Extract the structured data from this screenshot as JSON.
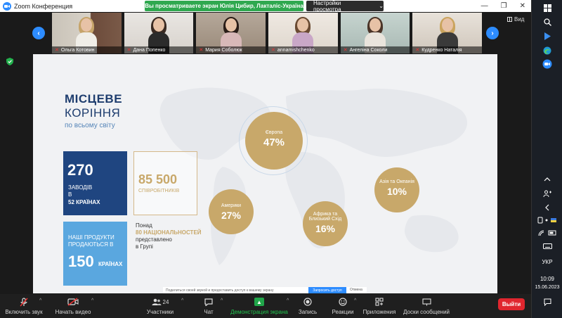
{
  "window": {
    "app_title": "Zoom Конференция",
    "share_banner": "Вы просматриваете экран Юлія Цибир, Лакталіс-Україна",
    "view_options_label": "Настройки просмотра",
    "view_options_caret": "⌄",
    "controls": {
      "minimize": "—",
      "restore": "❐",
      "close": "✕"
    }
  },
  "gallery": {
    "prev_arrow": "‹",
    "next_arrow": "›",
    "view_label": "Вид",
    "participants": [
      {
        "name": "Ольга Котовин",
        "muted": true
      },
      {
        "name": "Дана Попенко",
        "muted": true
      },
      {
        "name": "Мария Соболюк",
        "muted": true
      },
      {
        "name": "annamishchenko",
        "muted": true
      },
      {
        "name": "Ангеліна Соколи",
        "muted": true
      },
      {
        "name": "Кудренко Наталія",
        "muted": true
      }
    ]
  },
  "slide": {
    "title_line1": "МІСЦЕВЕ",
    "title_line2": "КОРІННЯ",
    "subtitle": "по всьому світу",
    "plants": {
      "value": "270",
      "line1": "ЗАВОДІВ",
      "line2": "В",
      "line3": "52 КРАЇНАХ"
    },
    "employees": {
      "value": "85 500",
      "label": "СПІВРОБІТНИКІВ"
    },
    "products": {
      "line1": "НАШІ ПРОДУКТИ",
      "line2": "ПРОДАЮТЬСЯ В",
      "value": "150",
      "unit": "КРАЇНАХ"
    },
    "nationalities": {
      "line1": "Понад",
      "line2": "80 НАЦІОНАЛЬНОСТЕЙ",
      "line3": "представлено",
      "line4": "в Групі"
    },
    "regions": [
      {
        "id": "europe",
        "label": "Європа",
        "share": "47%"
      },
      {
        "id": "americas",
        "label": "Америки",
        "share": "27%"
      },
      {
        "id": "africa",
        "label_line1": "Африка та",
        "label_line2": "Близький Схід",
        "share": "16%"
      },
      {
        "id": "asia",
        "label": "Азія та Океанія",
        "share": "10%"
      }
    ]
  },
  "permission_bar": {
    "text": "Поделиться своей звукой и предоставить доступ к вашему экрану",
    "button": "Запросить доступ",
    "cancel": "Отмена"
  },
  "toolbar": {
    "mute": "Включить звук",
    "video": "Начать видео",
    "participants": "Участники",
    "participants_count": "24",
    "chat": "Чат",
    "share": "Демонстрация экрана",
    "record": "Запись",
    "reactions": "Реакции",
    "apps": "Приложения",
    "whiteboard": "Доски сообщений",
    "leave": "Выйти",
    "caret": "^"
  },
  "taskbar": {
    "language": "УКР",
    "time": "10:09",
    "date": "15.06.2023"
  },
  "colors": {
    "zoom_blue": "#2d8cff",
    "banner_green": "#2fa84f",
    "navy": "#1f4580",
    "gold": "#c8a86a",
    "light_blue": "#5aa7df",
    "leave_red": "#e0262e"
  }
}
